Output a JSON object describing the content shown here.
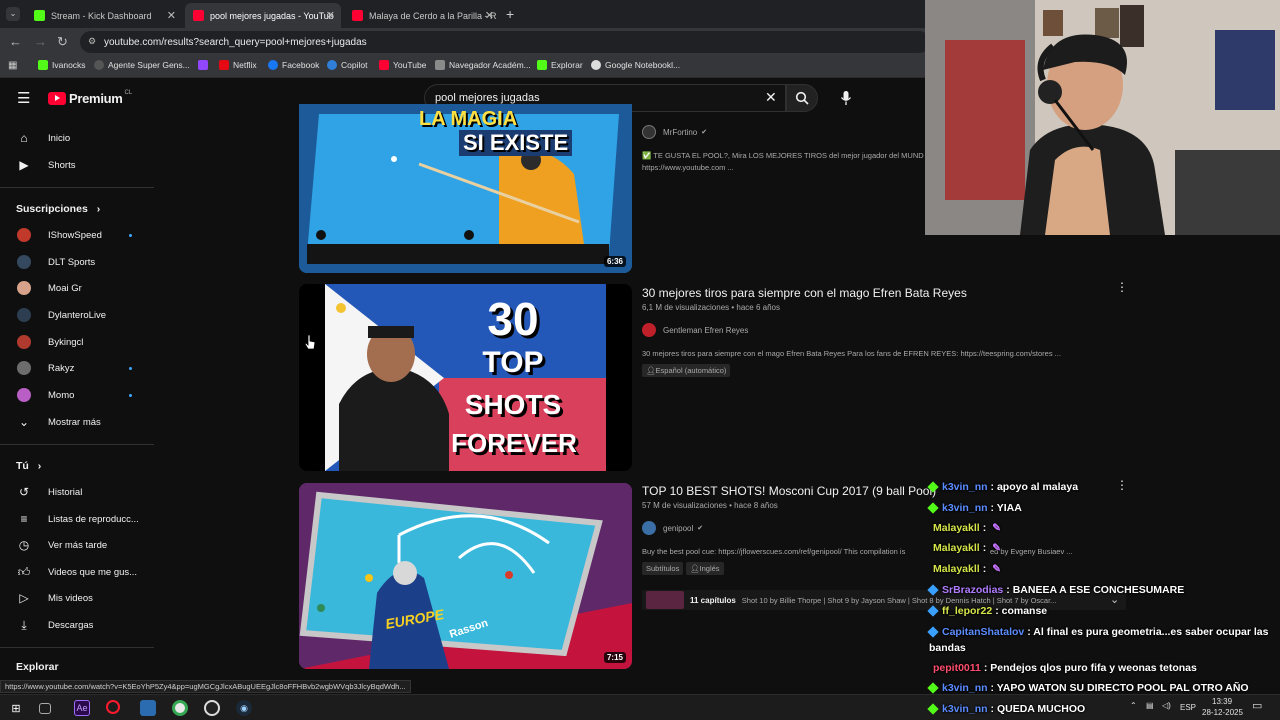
{
  "browser": {
    "tabs": [
      {
        "label": "Stream - Kick Dashboard",
        "color": "#53fc18",
        "active": false
      },
      {
        "label": "pool mejores jugadas - YouTub",
        "color": "#ff0033",
        "active": true
      },
      {
        "label": "Malaya de Cerdo a la Parilla - R",
        "color": "#ff0033",
        "active": false
      }
    ],
    "url": "youtube.com/results?search_query=pool+mejores+jugadas",
    "bookmarks": [
      "Ivanocks",
      "Agente Super Gens...",
      "",
      "Netflix",
      "Facebook",
      "Copilot",
      "YouTube",
      "Navegador Académ...",
      "Explorar",
      "Google Notebookl..."
    ]
  },
  "youtube": {
    "logo_text": "Premium",
    "logo_region": "CL",
    "search_value": "pool mejores jugadas",
    "sidebar": {
      "main": [
        {
          "label": "Inicio",
          "icon": "home-icon"
        },
        {
          "label": "Shorts",
          "icon": "shorts-icon"
        }
      ],
      "subs_header": "Suscripciones",
      "subs": [
        {
          "label": "IShowSpeed",
          "color": "#c0392b",
          "dot": true
        },
        {
          "label": "DLT Sports",
          "color": "#34495e",
          "dot": false
        },
        {
          "label": "Moai Gr",
          "color": "#d7a28a",
          "dot": false
        },
        {
          "label": "DylanteroLive",
          "color": "#2c3e50",
          "dot": false
        },
        {
          "label": "Bykingcl",
          "color": "#b03a2e",
          "dot": false
        },
        {
          "label": "Rakyz",
          "color": "#6d6d6d",
          "dot": true
        },
        {
          "label": "Momo",
          "color": "#b95ec4",
          "dot": true
        }
      ],
      "more": "Mostrar más",
      "you_header": "Tú",
      "you": [
        {
          "label": "Historial",
          "icon": "history-icon"
        },
        {
          "label": "Listas de reproducc...",
          "icon": "playlists-icon"
        },
        {
          "label": "Ver más tarde",
          "icon": "watch-later-icon"
        },
        {
          "label": "Videos que me gus...",
          "icon": "like-icon"
        },
        {
          "label": "Mis videos",
          "icon": "my-videos-icon"
        },
        {
          "label": "Descargas",
          "icon": "downloads-icon"
        }
      ],
      "explore_header": "Explorar"
    },
    "results": [
      {
        "thumb_text_1": "LA MAGIA",
        "thumb_text_2": "SI EXISTE",
        "duration": "6:36",
        "channel": "MrFortino",
        "description": "✅ TE GUSTA EL POOL?, Mira LOS MEJORES TIROS del mejor jugador del MUND",
        "description_2": "https://www.youtube.com ..."
      },
      {
        "thumb_lines": [
          "30",
          "TOP",
          "SHOTS",
          "FOREVER"
        ],
        "title": "30 mejores tiros para siempre con el mago Efren Bata Reyes",
        "meta": "6,1 M de visualizaciones • hace 6 años",
        "channel": "Gentleman Efren Reyes",
        "description": "30 mejores tiros para siempre con el mago Efren Bata Reyes Para los fans de EFREN REYES: https://teespring.com/stores ...",
        "badge": "Español (automático)"
      },
      {
        "title": "TOP 10 BEST SHOTS! Mosconi Cup 2017 (9 ball Pool)",
        "meta": "57 M de visualizaciones • hace 8 años",
        "channel": "genipool",
        "description": "Buy the best pool cue: https://jflowerscues.com/ref/genipool/ This compilation is",
        "description_tail": "ed by Evgeny Busiaev ...",
        "badges": [
          "Subtítulos",
          "Inglés"
        ],
        "chapters_label": "11 capítulos",
        "chapters_text": "Shot 10 by Billie Thorpe | Shot 9 by Jayson Shaw | Shot 8 by Dennis Hatch | Shot 7 by Oscar...",
        "duration": "7:15",
        "thumb_text": "EUROPE",
        "thumb_text_2": "Rasson"
      }
    ]
  },
  "chat": [
    {
      "user": "k3vin_nn",
      "msg": ": apoyo al malaya",
      "ucolor": "#5b8cff",
      "gem": "#53fc18"
    },
    {
      "user": "k3vin_nn",
      "msg": ": YIAA",
      "ucolor": "#5b8cff",
      "gem": "#53fc18"
    },
    {
      "user": "Malayakll",
      "msg": ":",
      "ucolor": "#d6e64a",
      "gem": ""
    },
    {
      "user": "Malayakll",
      "msg": ":",
      "ucolor": "#d6e64a",
      "gem": ""
    },
    {
      "user": "Malayakll",
      "msg": ":",
      "ucolor": "#d6e64a",
      "gem": ""
    },
    {
      "user": "SrBrazodias",
      "msg": ": BANEEA A ESE CONCHESUMARE",
      "ucolor": "#b07cff",
      "gem": "#3aa0ff"
    },
    {
      "user": "ff_lepor22",
      "msg": ": comanse",
      "ucolor": "#d6e64a",
      "gem": "#3aa0ff"
    },
    {
      "user": "CapitanShatalov",
      "msg": ": Al final es pura geometria...es saber ocupar las",
      "ucolor": "#5b8cff",
      "gem": "#3aa0ff"
    },
    {
      "user": "",
      "msg": "bandas",
      "ucolor": "#ffffff",
      "gem": ""
    },
    {
      "user": "pepit0011",
      "msg": ": Pendejos qlos puro fifa y weonas tetonas",
      "ucolor": "#ff4d6d",
      "gem": ""
    },
    {
      "user": "k3vin_nn",
      "msg": ": YAPO WATON SU DIRECTO POOL PAL OTRO AÑO",
      "ucolor": "#5b8cff",
      "gem": "#53fc18"
    },
    {
      "user": "k3vin_nn",
      "msg": ": QUEDA MUCHOO",
      "ucolor": "#5b8cff",
      "gem": "#53fc18"
    }
  ],
  "status_url": "https://www.youtube.com/watch?v=K5EoYhP5Zy4&pp=ugMGCgJlcxABugUEEgJlc8oFFHBvb2wgbWVqb3JlcyBqdWdh...",
  "taskbar": {
    "lang": "ESP",
    "time": "13:39",
    "date": "28-12-2025"
  }
}
